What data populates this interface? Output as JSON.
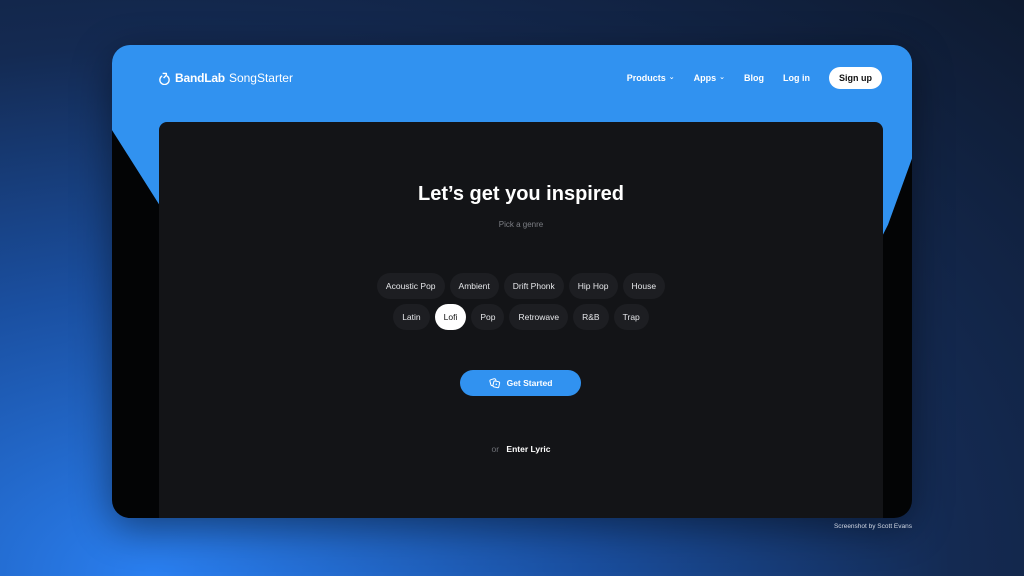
{
  "header": {
    "brand_bold": "BandLab",
    "brand_light": "SongStarter",
    "logo_icon": "bandlab-logo-icon",
    "nav": [
      {
        "label": "Products",
        "has_dropdown": true
      },
      {
        "label": "Apps",
        "has_dropdown": true
      },
      {
        "label": "Blog",
        "has_dropdown": false
      },
      {
        "label": "Log in",
        "has_dropdown": false
      }
    ],
    "signup_label": "Sign up",
    "chevron": "⌄"
  },
  "main": {
    "title": "Let’s get you inspired",
    "subtitle": "Pick a genre",
    "genres_row1": [
      "Acoustic Pop",
      "Ambient",
      "Drift Phonk",
      "Hip Hop",
      "House"
    ],
    "genres_row2": [
      "Latin",
      "Lofi",
      "Pop",
      "Retrowave",
      "R&B",
      "Trap"
    ],
    "selected_genre": "Lofi",
    "cta_label": "Get Started",
    "cta_icon": "dice-icon",
    "alt_or": "or",
    "alt_link": "Enter Lyric"
  },
  "credit": "Screenshot by Scott Evans",
  "colors": {
    "accent": "#3192f0",
    "panel": "#131417",
    "chip": "#1d1e22"
  }
}
